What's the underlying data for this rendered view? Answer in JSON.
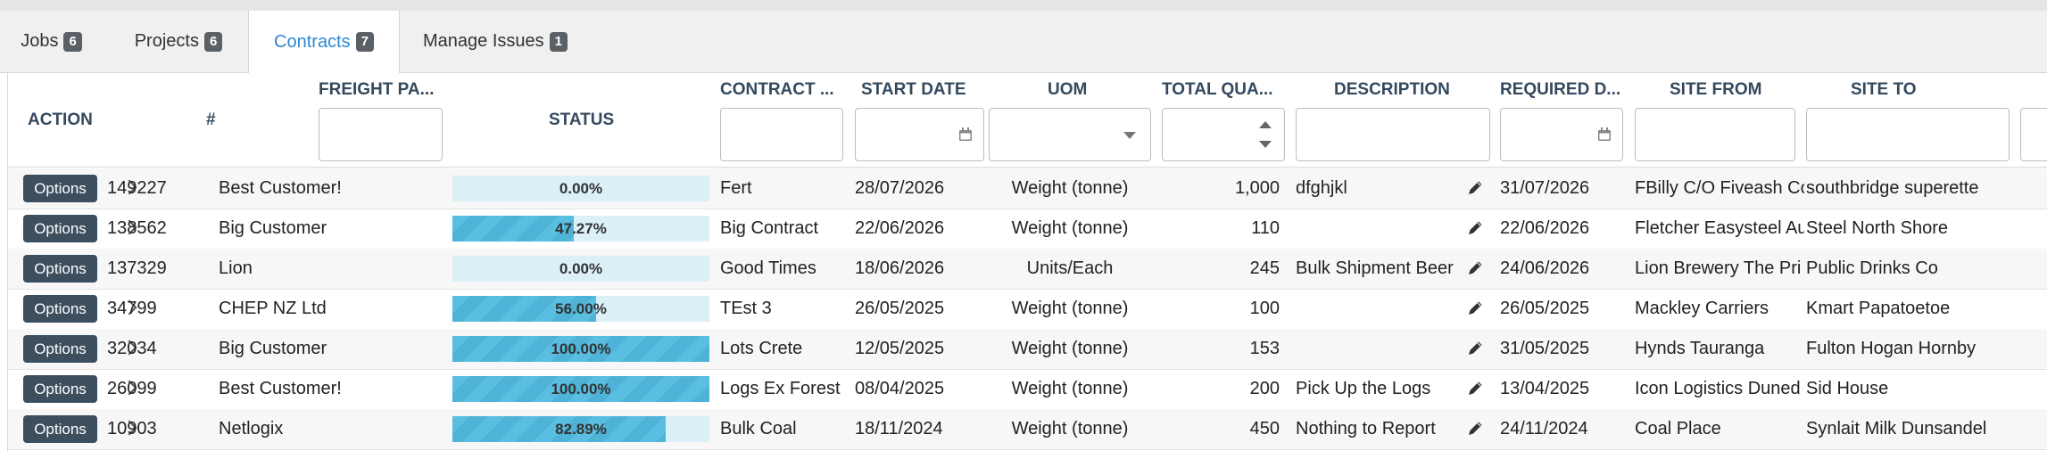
{
  "tabs": [
    {
      "label": "Jobs",
      "count": "6"
    },
    {
      "label": "Projects",
      "count": "6"
    },
    {
      "label": "Contracts",
      "count": "7"
    },
    {
      "label": "Manage Issues",
      "count": "1"
    }
  ],
  "active_tab": "Contracts",
  "columns": {
    "action": "ACTION",
    "number": "#",
    "freight_party": "FREIGHT PA...",
    "status": "STATUS",
    "contract": "CONTRACT ...",
    "start_date": "START DATE",
    "uom": "UOM",
    "total_quantity": "TOTAL QUA...",
    "description": "DESCRIPTION",
    "required_date": "REQUIRED D...",
    "site_from": "SITE FROM",
    "site_to": "SITE TO"
  },
  "filters": {
    "freight_party": "",
    "contract": "",
    "start_date": "",
    "uom": "",
    "total_quantity": "",
    "description": "",
    "required_date": "",
    "site_from": "",
    "site_to": ""
  },
  "options_label": "Options",
  "colors": {
    "accent": "#2f86d1",
    "button": "#3d4e5f",
    "progress_fill": "#59bedf",
    "progress_track": "#dcf0f8",
    "header_text": "#34495e"
  },
  "rows": [
    {
      "id": "149227",
      "freight_party": "Best Customer!",
      "progress": 0.0,
      "status": "0.00%",
      "contract": "Fert",
      "start_date": "28/07/2026",
      "uom": "Weight (tonne)",
      "total_quantity": "1,000",
      "description": "dfghjkl",
      "required_date": "31/07/2026",
      "site_from": "FBilly C/O Fiveash Co",
      "site_to": "southbridge superette",
      "expandable": true
    },
    {
      "id": "138562",
      "freight_party": "Big Customer",
      "progress": 47.27,
      "status": "47.27%",
      "contract": "Big Contract",
      "start_date": "22/06/2026",
      "uom": "Weight (tonne)",
      "total_quantity": "110",
      "description": "",
      "required_date": "22/06/2026",
      "site_from": "Fletcher Easysteel Au",
      "site_to": "Steel North Shore",
      "expandable": true
    },
    {
      "id": "137329",
      "freight_party": "Lion",
      "progress": 0.0,
      "status": "0.00%",
      "contract": "Good Times",
      "start_date": "18/06/2026",
      "uom": "Units/Each",
      "total_quantity": "245",
      "description": "Bulk Shipment Beer",
      "required_date": "24/06/2026",
      "site_from": "Lion Brewery The Pri",
      "site_to": "Public Drinks Co",
      "expandable": false
    },
    {
      "id": "34799",
      "freight_party": "CHEP NZ Ltd",
      "progress": 56.0,
      "status": "56.00%",
      "contract": "TEst 3",
      "start_date": "26/05/2025",
      "uom": "Weight (tonne)",
      "total_quantity": "100",
      "description": "",
      "required_date": "26/05/2025",
      "site_from": "Mackley Carriers",
      "site_to": "Kmart Papatoetoe",
      "expandable": true
    },
    {
      "id": "32034",
      "freight_party": "Big Customer",
      "progress": 100.0,
      "status": "100.00%",
      "contract": "Lots Crete",
      "start_date": "12/05/2025",
      "uom": "Weight (tonne)",
      "total_quantity": "153",
      "description": "",
      "required_date": "31/05/2025",
      "site_from": "Hynds Tauranga",
      "site_to": "Fulton Hogan Hornby",
      "expandable": true
    },
    {
      "id": "26099",
      "freight_party": "Best Customer!",
      "progress": 100.0,
      "status": "100.00%",
      "contract": "Logs Ex Forest",
      "start_date": "08/04/2025",
      "uom": "Weight (tonne)",
      "total_quantity": "200",
      "description": "Pick Up the Logs",
      "required_date": "13/04/2025",
      "site_from": "Icon Logistics Duned",
      "site_to": "Sid House",
      "expandable": true
    },
    {
      "id": "10903",
      "freight_party": "Netlogix",
      "progress": 82.89,
      "status": "82.89%",
      "contract": "Bulk Coal",
      "start_date": "18/11/2024",
      "uom": "Weight (tonne)",
      "total_quantity": "450",
      "description": "Nothing to Report",
      "required_date": "24/11/2024",
      "site_from": "Coal Place",
      "site_to": "Synlait Milk Dunsandel",
      "expandable": true
    }
  ]
}
